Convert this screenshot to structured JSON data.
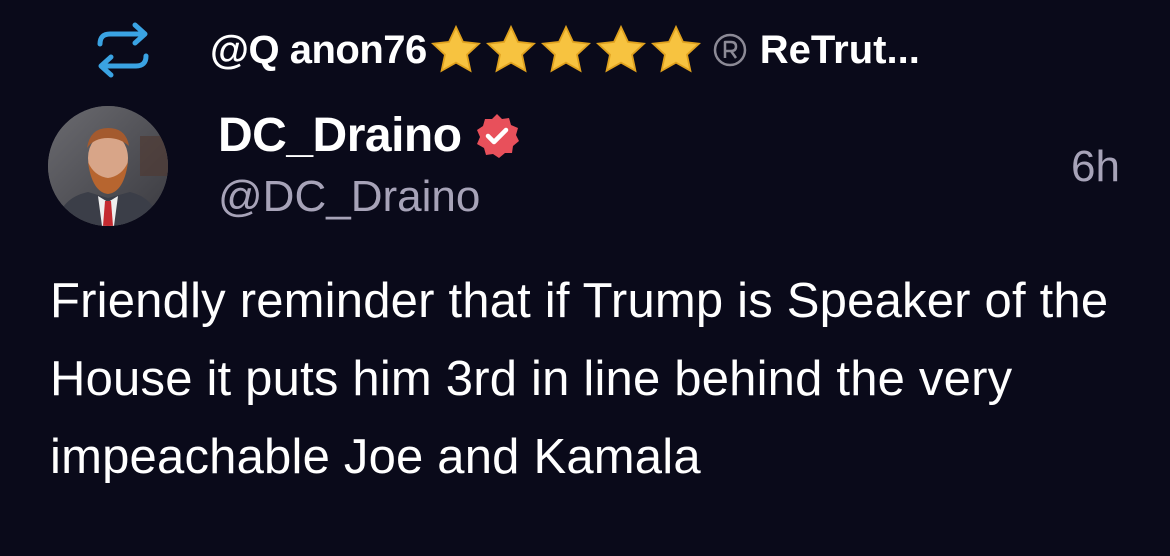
{
  "retruth": {
    "icon": "retruth-icon",
    "username": "@Q anon76",
    "stars_count": 5,
    "star_icon": "star-emoji",
    "registered_icon": "registered-mark-icon",
    "label": "ReTrut..."
  },
  "post": {
    "author": {
      "display_name": "DC_Draino",
      "handle": "@DC_Draino",
      "verified_icon": "verified-badge-icon",
      "verified_color": "#e8505b",
      "avatar": "avatar"
    },
    "timestamp": "6h",
    "text": "Friendly reminder that if Trump is Speaker of the House it puts him 3rd in line behind the very impeachable Joe and Kamala"
  },
  "colors": {
    "background": "#0a0a1a",
    "retruth_accent": "#3aa3e3",
    "muted_text": "#a7a3b8",
    "star": "#f7c340"
  }
}
